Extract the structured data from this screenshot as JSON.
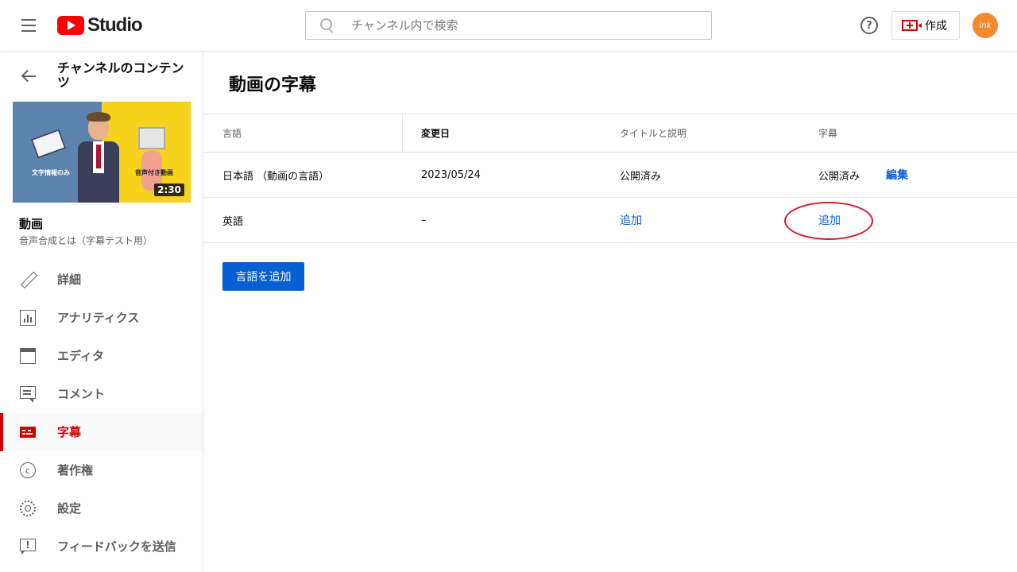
{
  "app": {
    "logo_text": "Studio"
  },
  "header": {
    "search_placeholder": "チャンネル内で検索",
    "help_label": "?",
    "create_label": "作成",
    "avatar_text": "ink"
  },
  "sidebar": {
    "title": "チャンネルのコンテンツ",
    "thumbnail": {
      "caption_left": "文字情報のみ",
      "caption_right": "音声付き動画",
      "duration": "2:30"
    },
    "video_label": "動画",
    "video_title": "音声合成とは（字幕テスト用）",
    "items": [
      {
        "label": "詳細",
        "icon": "pencil-icon"
      },
      {
        "label": "アナリティクス",
        "icon": "analytics-icon"
      },
      {
        "label": "エディタ",
        "icon": "editor-icon"
      },
      {
        "label": "コメント",
        "icon": "comment-icon"
      },
      {
        "label": "字幕",
        "icon": "subtitles-icon",
        "active": true
      },
      {
        "label": "著作権",
        "icon": "copyright-icon",
        "glyph": "c"
      },
      {
        "label": "設定",
        "icon": "gear-icon"
      },
      {
        "label": "フィードバックを送信",
        "icon": "feedback-icon",
        "glyph": "!"
      }
    ]
  },
  "main": {
    "title": "動画の字幕",
    "table": {
      "headers": [
        "言語",
        "変更日",
        "タイトルと説明",
        "字幕"
      ],
      "rows": [
        {
          "language": "日本語 （動画の言語）",
          "modified": "2023/05/24",
          "title_desc": "公開済み",
          "subtitles": "公開済み",
          "action": "編集"
        },
        {
          "language": "英語",
          "modified": "–",
          "title_desc": "追加",
          "subtitles": "追加"
        }
      ]
    },
    "add_language_button": "言語を追加"
  },
  "colors": {
    "accent_red": "#cc0000",
    "link_blue": "#065fd4",
    "annotation_red": "#d81b2a"
  }
}
